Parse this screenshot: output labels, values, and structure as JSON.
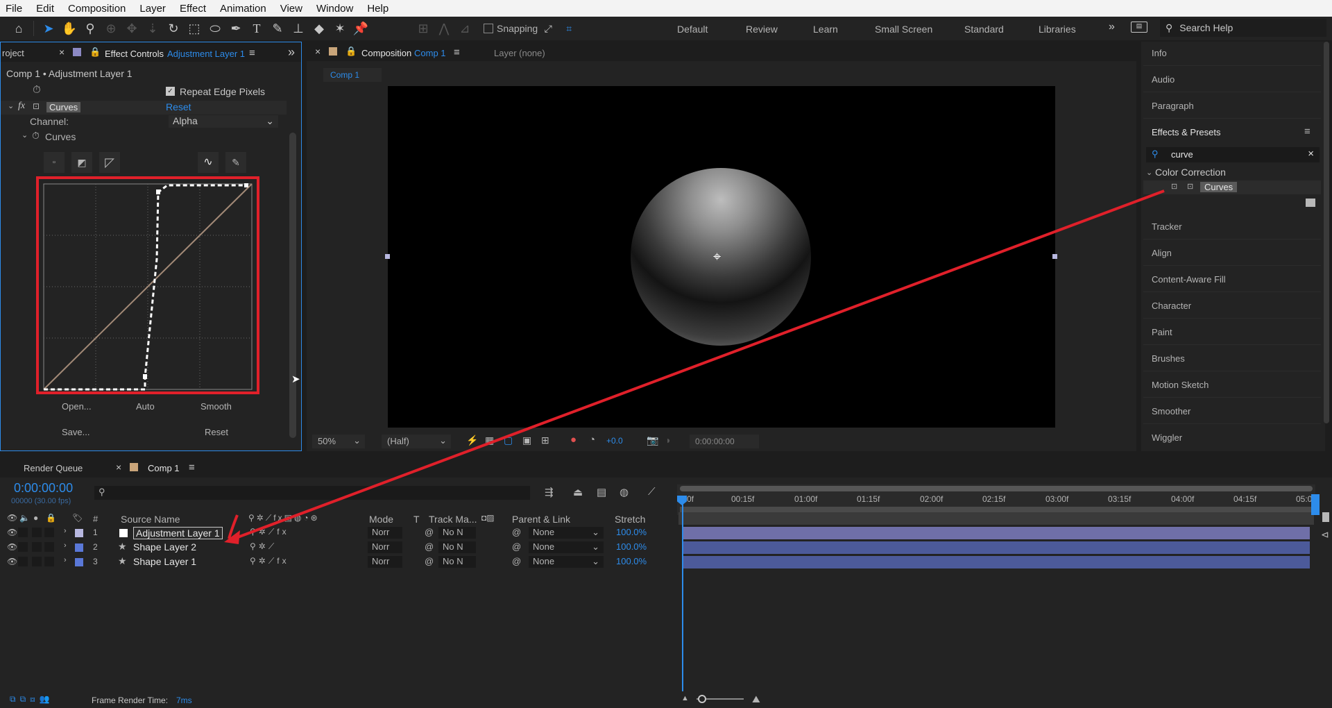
{
  "menu": [
    "File",
    "Edit",
    "Composition",
    "Layer",
    "Effect",
    "Animation",
    "View",
    "Window",
    "Help"
  ],
  "toolbar": {
    "snapping_label": "Snapping",
    "workspaces": [
      "Default",
      "Review",
      "Learn",
      "Small Screen",
      "Standard",
      "Libraries"
    ],
    "search_help_placeholder": "Search Help"
  },
  "effect_controls": {
    "project_tab": "roject",
    "tab_label": "Effect Controls",
    "tab_layer": "Adjustment Layer 1",
    "breadcrumb": "Comp 1 • Adjustment Layer 1",
    "repeat_edge_label": "Repeat Edge Pixels",
    "effect_name": "Curves",
    "reset_label": "Reset",
    "channel_label": "Channel:",
    "channel_value": "Alpha",
    "curves_sublabel": "Curves",
    "buttons": [
      "Open...",
      "Auto",
      "Smooth",
      "Save...",
      "Reset"
    ]
  },
  "composition": {
    "tab_label": "Composition",
    "tab_comp": "Comp 1",
    "layer_tab": "Layer (none)",
    "comp_chip": "Comp 1",
    "zoom": "50%",
    "resolution": "(Half)",
    "exposure": "+0.0",
    "timecode": "0:00:00:00"
  },
  "right_panel": {
    "items_top": [
      "Info",
      "Audio",
      "Paragraph"
    ],
    "effects_title": "Effects & Presets",
    "search_value": "curve",
    "category": "Color Correction",
    "result": "Curves",
    "items_bottom": [
      "Tracker",
      "Align",
      "Content-Aware Fill",
      "Character",
      "Paint",
      "Brushes",
      "Motion Sketch",
      "Smoother",
      "Wiggler"
    ]
  },
  "timeline": {
    "render_queue_tab": "Render Queue",
    "comp_tab": "Comp 1",
    "timecode": "0:00:00:00",
    "frame_info": "00000 (30.00 fps)",
    "columns": {
      "num": "#",
      "source": "Source Name",
      "mode": "Mode",
      "t": "T",
      "track": "Track Ma...",
      "parent": "Parent & Link",
      "stretch": "Stretch"
    },
    "ruler": [
      "0f",
      "00:15f",
      "01:00f",
      "01:15f",
      "02:00f",
      "02:15f",
      "03:00f",
      "03:15f",
      "04:00f",
      "04:15f",
      "05:0"
    ],
    "layers": [
      {
        "num": "1",
        "name": "Adjustment Layer 1",
        "mode": "Norr",
        "track": "No N",
        "parent": "None",
        "stretch": "100.0%"
      },
      {
        "num": "2",
        "name": "Shape Layer 2",
        "mode": "Norr",
        "track": "No N",
        "parent": "None",
        "stretch": "100.0%"
      },
      {
        "num": "3",
        "name": "Shape Layer 1",
        "mode": "Norr",
        "track": "No N",
        "parent": "None",
        "stretch": "100.0%"
      }
    ],
    "render_time_label": "Frame Render Time:",
    "render_time_value": "7ms"
  },
  "colors": {
    "accent_blue": "#2d8ceb",
    "annotation_red": "#e0202a",
    "layer_bar": "#4c5a9a",
    "curve_line": "#a38a77"
  }
}
